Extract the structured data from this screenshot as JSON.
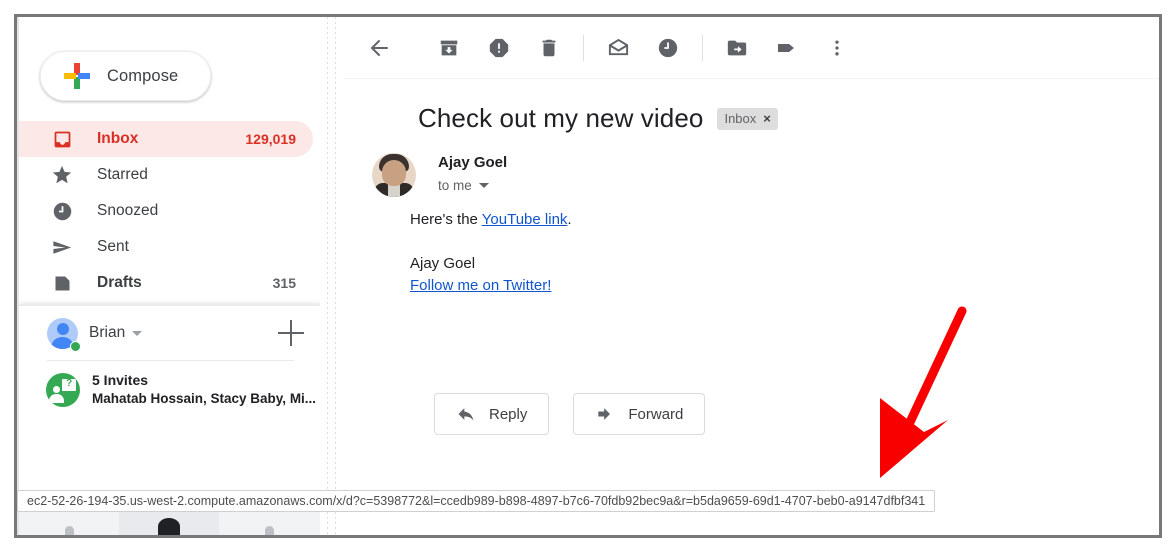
{
  "sidebar": {
    "compose": {
      "label": "Compose",
      "icon": "google-plus-icon"
    },
    "nav_items": [
      {
        "label": "Inbox",
        "count": "129,019",
        "icon": "inbox-icon",
        "active": true
      },
      {
        "label": "Starred",
        "count": "",
        "icon": "star-icon",
        "active": false
      },
      {
        "label": "Snoozed",
        "count": "",
        "icon": "clock-icon",
        "active": false
      },
      {
        "label": "Sent",
        "count": "",
        "icon": "send-icon",
        "active": false
      },
      {
        "label": "Drafts",
        "count": "315",
        "icon": "drafts-icon",
        "active": false
      }
    ],
    "hangouts": {
      "user_name": "Brian",
      "status": "online",
      "add_label": "+",
      "invites_title": "5 Invites",
      "invites_names": "Mahatab Hossain, Stacy Baby, Mi..."
    }
  },
  "toolbar": {
    "buttons": [
      {
        "name": "back",
        "title": "Back to Inbox"
      },
      {
        "name": "archive",
        "title": "Archive"
      },
      {
        "name": "report-spam",
        "title": "Report spam"
      },
      {
        "name": "delete",
        "title": "Delete"
      },
      {
        "name": "mark-unread",
        "title": "Mark as unread"
      },
      {
        "name": "snooze",
        "title": "Snooze"
      },
      {
        "name": "move-to",
        "title": "Move to"
      },
      {
        "name": "labels",
        "title": "Labels"
      },
      {
        "name": "more",
        "title": "More"
      }
    ]
  },
  "email": {
    "subject": "Check out my new video",
    "label_chip": "Inbox",
    "label_chip_remove": "×",
    "sender_name": "Ajay Goel",
    "recipient": "to me",
    "body_line_1_prefix": "Here's the ",
    "body_line_1_link": "YouTube link",
    "body_line_1_suffix": ".",
    "signature_name": "Ajay Goel",
    "signature_link": "Follow me on Twitter!",
    "reply_label": "Reply",
    "forward_label": "Forward"
  },
  "status_bar": {
    "url": "ec2-52-26-194-35.us-west-2.compute.amazonaws.com/x/d?c=5398772&l=ccedb989-b898-4897-b7c6-70fdb92bec9a&r=b5da9659-69d1-4707-beb0-a9147dfbf341"
  },
  "annotation": {
    "type": "red-arrow",
    "color": "#f90000",
    "points_to": "status-bar-url"
  },
  "colors": {
    "accent_red": "#d93025",
    "inbox_highlight": "#fce8e6",
    "link_blue": "#1155cc",
    "text_primary": "#202124",
    "text_secondary": "#5f6368",
    "frame_border": "#77787a"
  }
}
